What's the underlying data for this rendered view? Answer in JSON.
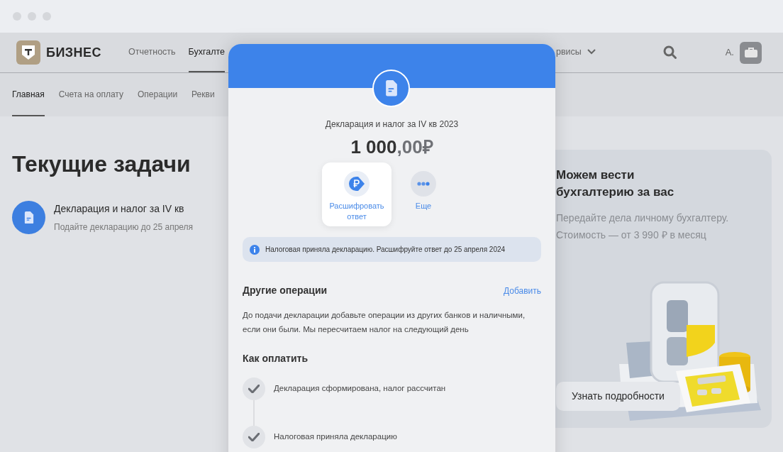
{
  "header": {
    "logo_text": "БИЗНЕС",
    "nav": [
      {
        "label": "Отчетность",
        "selected": false
      },
      {
        "label": "Бухгалте",
        "selected": true
      }
    ],
    "nav_right": [
      {
        "label": "рвисы",
        "selected": false,
        "has_menu": true
      }
    ],
    "user_name": "А."
  },
  "subnav": [
    {
      "label": "Главная",
      "selected": true
    },
    {
      "label": "Счета на оплату",
      "selected": false
    },
    {
      "label": "Операции",
      "selected": false
    },
    {
      "label": "Рекви",
      "selected": false
    }
  ],
  "page": {
    "title": "Текущие задачи",
    "tasks": [
      {
        "title": "Декларация и налог за IV кв",
        "subtitle": "Подайте декларацию до 25 апреля"
      }
    ]
  },
  "promo": {
    "title": "Можем вести бухгалтерию за вас",
    "text": "Передайте дела личному бухгалтеру. Стоимость — от 3 990 ₽ в месяц",
    "button": "Узнать подробности"
  },
  "modal": {
    "title": "Декларация и налог за IV кв 2023",
    "amount_main": "1 000",
    "amount_fraction": ",00₽",
    "actions": [
      {
        "kind": "ruble",
        "label": "Расшифровать ответ",
        "selected": true
      },
      {
        "kind": "more",
        "label": "Еще",
        "selected": false
      }
    ],
    "notice": "Налоговая приняла декларацию. Расшифруйте ответ до 25 апреля 2024",
    "other_ops": {
      "title": "Другие операции",
      "link": "Добавить",
      "text": "До подачи декларации добавьте операции из других банков и наличными, если они были. Мы пересчитаем налог на следующий день"
    },
    "pay": {
      "title": "Как оплатить",
      "steps": [
        {
          "label": "Декларация сформирована, налог рассчитан",
          "done": true
        },
        {
          "label": "Налоговая приняла декларацию",
          "done": true
        }
      ]
    }
  }
}
